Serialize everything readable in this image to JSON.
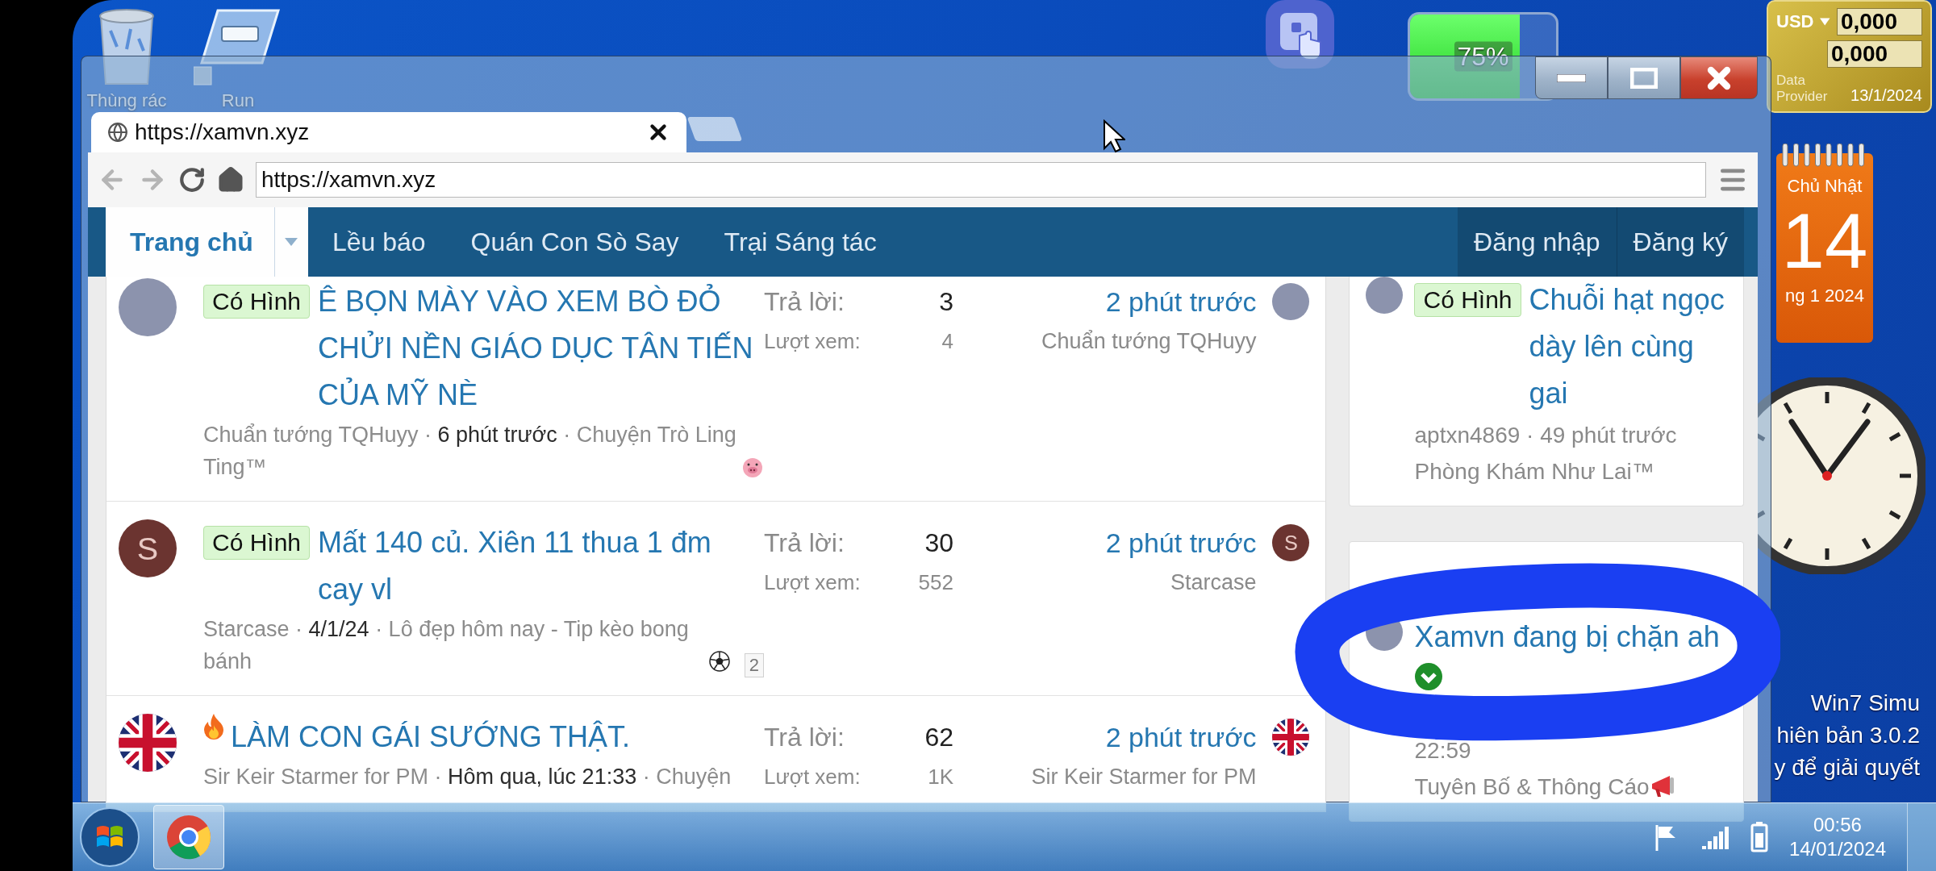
{
  "desktop_icons": [
    {
      "label": "Thùng rác",
      "kind": "bin"
    },
    {
      "label": "Run",
      "kind": "run"
    }
  ],
  "battery_widget": {
    "reading": "75%",
    "level": 0.75
  },
  "currency_widget": {
    "currency": "USD",
    "values": [
      "0,000",
      "0,000"
    ],
    "provider": "Data Provider",
    "date": "13/1/2024"
  },
  "calendar_widget": {
    "weekday": "Chủ Nhật",
    "day": "14",
    "month": "ng 1 2024"
  },
  "desktop_text": [
    "Win7 Simu",
    "hiên bản 3.0.2",
    "y để giải quyết"
  ],
  "browser": {
    "tab_title": "https://xamvn.xyz",
    "nav_buttons": [
      {
        "kind": "back",
        "disabled": true
      },
      {
        "kind": "forward",
        "disabled": true
      },
      {
        "kind": "reload",
        "disabled": false
      },
      {
        "kind": "home",
        "disabled": false
      }
    ],
    "address": "https://xamvn.xyz"
  },
  "site_nav": {
    "items": [
      {
        "label": "Trang chủ",
        "selected": true
      },
      {
        "label": "Lều báo",
        "selected": false
      },
      {
        "label": "Quán Con Sò Say",
        "selected": false
      },
      {
        "label": "Trại Sáng tác",
        "selected": false
      }
    ],
    "account": [
      "Đăng nhập",
      "Đăng ký"
    ]
  },
  "threads": [
    {
      "avatar": {
        "kind": "photo"
      },
      "prefix": "Có Hình",
      "hot": false,
      "title": "Ê BỌN MÀY VÀO XEM BÒ ĐỎ CHỬI NỀN GIÁO DỤC TÂN TIẾN CỦA MỸ NÈ",
      "meta": "Chuẩn tướng TQHuyy · **6 phút trước** · Chuyện Trò Ling Ting™",
      "forum_emoji": {
        "kind": "pig"
      },
      "replies_label": "Trả lời:",
      "replies": "3",
      "views_label": "Lượt xem:",
      "views": "4",
      "last_time": "2 phút trước",
      "last_user": "Chuẩn tướng TQHuyy",
      "last_avatar": {
        "kind": "photo"
      }
    },
    {
      "avatar": {
        "kind": "letter",
        "letter": "S",
        "color": "#6b3430"
      },
      "prefix": "Có Hình",
      "hot": false,
      "title": "Mất 140 củ. Xiên 11 thua 1 đm cay vl",
      "meta": "Starcase · **4/1/24** · Lô đẹp hôm nay - Tip kèo bong bánh",
      "forum_emoji": {
        "kind": "ball"
      },
      "pages": [
        "2"
      ],
      "replies_label": "Trả lời:",
      "replies": "30",
      "views_label": "Lượt xem:",
      "views": "552",
      "last_time": "2 phút trước",
      "last_user": "Starcase",
      "last_avatar": {
        "kind": "letter",
        "letter": "S",
        "color": "#6b3430"
      }
    },
    {
      "avatar": {
        "kind": "flag"
      },
      "hot": true,
      "title": "LÀM CON GÁI SƯỚNG THẬT.",
      "meta": "Sir Keir Starmer for PM · **Hôm qua, lúc 21:33** · Chuyện",
      "replies_label": "Trả lời:",
      "replies": "62",
      "views_label": "Lượt xem:",
      "views": "1K",
      "last_time": "2 phút trước",
      "last_user": "Sir Keir Starmer for PM",
      "last_avatar": {
        "kind": "flag"
      }
    }
  ],
  "sidebar": [
    {
      "avatar": {
        "kind": "photo"
      },
      "prefix": "Có Hình",
      "title": "Chuỗi hạt ngọc dày lên cùng gai",
      "verified": false,
      "meta": "aptxn4869 · 49 phút trước",
      "forum": "Phòng Khám Như Lai™",
      "highlighted": false
    },
    {
      "avatar": {
        "kind": "photo"
      },
      "title": "Xamvn đang bị chặn ah",
      "verified": true,
      "meta": "22:59",
      "forum": "Tuyên Bố & Thông Cáo",
      "forum_emoji": {
        "kind": "megaphone"
      },
      "highlighted": true
    }
  ],
  "taskbar": {
    "time": "00:56",
    "date": "14/01/2024"
  }
}
